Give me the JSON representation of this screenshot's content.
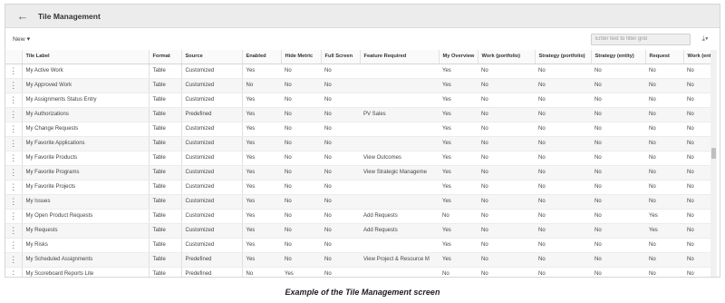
{
  "header": {
    "back_icon": "back-arrow-icon",
    "title": "Tile Management"
  },
  "toolbar": {
    "new_label": "New",
    "new_caret": "▾",
    "filter_placeholder": "Enter text to filter grid",
    "download_icon": "download-icon"
  },
  "grid": {
    "columns": [
      "Tile Label",
      "Format",
      "Source",
      "Enabled",
      "Hide Metric",
      "Full Screen",
      "Feature Required",
      "My Overview",
      "Work (portfolio)",
      "Strategy (portfolio)",
      "Strategy (entity)",
      "Request",
      "Work (entity)"
    ],
    "rows": [
      [
        "My Active Work",
        "Table",
        "Customized",
        "Yes",
        "No",
        "No",
        "",
        "Yes",
        "No",
        "No",
        "No",
        "No",
        "No"
      ],
      [
        "My Approved Work",
        "Table",
        "Customized",
        "No",
        "No",
        "No",
        "",
        "Yes",
        "No",
        "No",
        "No",
        "No",
        "No"
      ],
      [
        "My Assignments Status Entry",
        "Table",
        "Customized",
        "Yes",
        "No",
        "No",
        "",
        "Yes",
        "No",
        "No",
        "No",
        "No",
        "No"
      ],
      [
        "My Authorizations",
        "Table",
        "Predefined",
        "Yes",
        "No",
        "No",
        "PV Sales",
        "Yes",
        "No",
        "No",
        "No",
        "No",
        "No"
      ],
      [
        "My Change Requests",
        "Table",
        "Customized",
        "Yes",
        "No",
        "No",
        "",
        "Yes",
        "No",
        "No",
        "No",
        "No",
        "No"
      ],
      [
        "My Favorite Applications",
        "Table",
        "Customized",
        "Yes",
        "No",
        "No",
        "",
        "Yes",
        "No",
        "No",
        "No",
        "No",
        "No"
      ],
      [
        "My Favorite Products",
        "Table",
        "Customized",
        "Yes",
        "No",
        "No",
        "View Outcomes",
        "Yes",
        "No",
        "No",
        "No",
        "No",
        "No"
      ],
      [
        "My Favorite Programs",
        "Table",
        "Customized",
        "Yes",
        "No",
        "No",
        "View Strategic Manageme",
        "Yes",
        "No",
        "No",
        "No",
        "No",
        "No"
      ],
      [
        "My Favorite Projects",
        "Table",
        "Customized",
        "Yes",
        "No",
        "No",
        "",
        "Yes",
        "No",
        "No",
        "No",
        "No",
        "No"
      ],
      [
        "My Issues",
        "Table",
        "Customized",
        "Yes",
        "No",
        "No",
        "",
        "Yes",
        "No",
        "No",
        "No",
        "No",
        "No"
      ],
      [
        "My Open Product Requests",
        "Table",
        "Customized",
        "Yes",
        "No",
        "No",
        "Add Requests",
        "No",
        "No",
        "No",
        "No",
        "Yes",
        "No"
      ],
      [
        "My Requests",
        "Table",
        "Customized",
        "Yes",
        "No",
        "No",
        "Add Requests",
        "Yes",
        "No",
        "No",
        "No",
        "Yes",
        "No"
      ],
      [
        "My Risks",
        "Table",
        "Customized",
        "Yes",
        "No",
        "No",
        "",
        "Yes",
        "No",
        "No",
        "No",
        "No",
        "No"
      ],
      [
        "My Scheduled Assignments",
        "Table",
        "Predefined",
        "Yes",
        "No",
        "No",
        "View Project & Resource M",
        "Yes",
        "No",
        "No",
        "No",
        "No",
        "No"
      ],
      [
        "My Scoreboard Reports Lite",
        "Table",
        "Predefined",
        "No",
        "Yes",
        "No",
        "",
        "No",
        "No",
        "No",
        "No",
        "No",
        "No"
      ]
    ]
  },
  "caption": "Example of the Tile Management screen"
}
